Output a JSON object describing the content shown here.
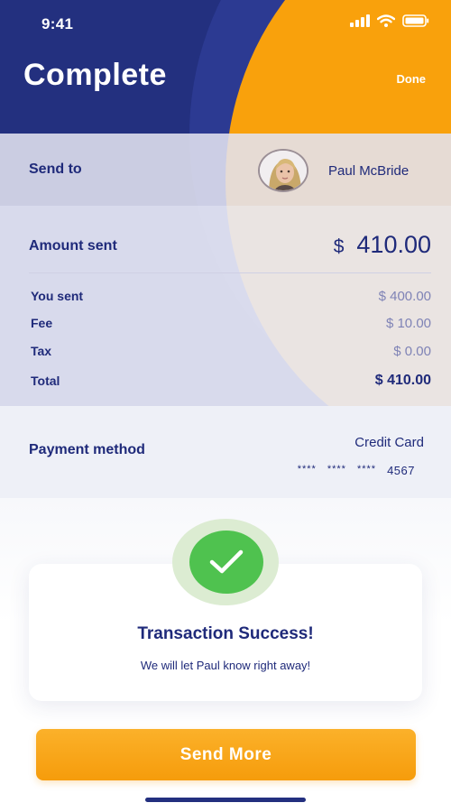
{
  "status_bar": {
    "time": "9:41",
    "icons": [
      "signal-icon",
      "wifi-icon",
      "battery-icon"
    ]
  },
  "nav": {
    "title": "Complete",
    "done_label": "Done"
  },
  "send_to": {
    "label": "Send to",
    "recipient_name": "Paul McBride"
  },
  "amount": {
    "label": "Amount sent",
    "currency": "$",
    "value": "410.00",
    "breakdown": [
      {
        "label": "You sent",
        "value": "$ 400.00"
      },
      {
        "label": "Fee",
        "value": "$ 10.00"
      },
      {
        "label": "Tax",
        "value": "$ 0.00"
      },
      {
        "label": "Total",
        "value": "$ 410.00"
      }
    ]
  },
  "payment": {
    "label": "Payment method",
    "type": "Credit Card",
    "mask_groups": [
      "****",
      "****",
      "****"
    ],
    "last4": "4567"
  },
  "success": {
    "title": "Transaction Success!",
    "subtitle": "We will let Paul know right away!"
  },
  "actions": {
    "send_more_label": "Send More"
  },
  "colors": {
    "navy": "#23307f",
    "orange": "#f9a10c",
    "success_green": "#4fc24f",
    "text_primary": "#1f2a7a",
    "text_muted": "#7f83b6"
  }
}
